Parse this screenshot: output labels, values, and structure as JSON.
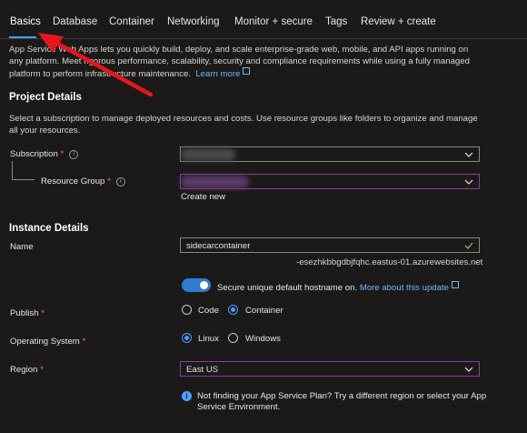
{
  "tabs": [
    {
      "label": "Basics",
      "active": true
    },
    {
      "label": "Database"
    },
    {
      "label": "Container"
    },
    {
      "label": "Networking"
    },
    {
      "label": "Monitor + secure"
    },
    {
      "label": "Tags"
    },
    {
      "label": "Review + create"
    }
  ],
  "intro": {
    "line1": "App Service Web Apps lets you quickly build, deploy, and scale enterprise-grade web, mobile, and API apps running on",
    "line2": "any platform. Meet rigorous performance, scalability, security and compliance requirements while using a fully managed",
    "line3": "platform to perform infrastructure maintenance.",
    "learn_more": "Learn more"
  },
  "project_details": {
    "heading": "Project Details",
    "desc_line1": "Select a subscription to manage deployed resources and costs. Use resource groups like folders to organize and manage",
    "desc_line2": "all your resources.",
    "subscription_label": "Subscription",
    "resource_group_label": "Resource Group",
    "create_new": "Create new"
  },
  "instance_details": {
    "heading": "Instance Details",
    "name_label": "Name",
    "name_value": "sidecarcontainer",
    "hostname_suffix": "-esezhkbbgdbjfqhc.eastus-01.azurewebsites.net",
    "secure_hostname_label": "Secure unique default hostname on.",
    "secure_hostname_link": "More about this update",
    "publish_label": "Publish",
    "publish_options": [
      "Code",
      "Container"
    ],
    "publish_selected": "Container",
    "os_label": "Operating System",
    "os_options": [
      "Linux",
      "Windows"
    ],
    "os_selected": "Linux",
    "region_label": "Region",
    "region_value": "East US",
    "plan_info_line1": "Not finding your App Service Plan? Try a different region or select your App",
    "plan_info_line2": "Service Environment."
  },
  "required_marker": "*",
  "colors": {
    "background": "#1b1a19",
    "accent": "#4a9eff",
    "link": "#6cb8f6",
    "required": "#f1707b",
    "annotation_arrow": "#e8161b",
    "purple_border": "#8f3d9c"
  }
}
